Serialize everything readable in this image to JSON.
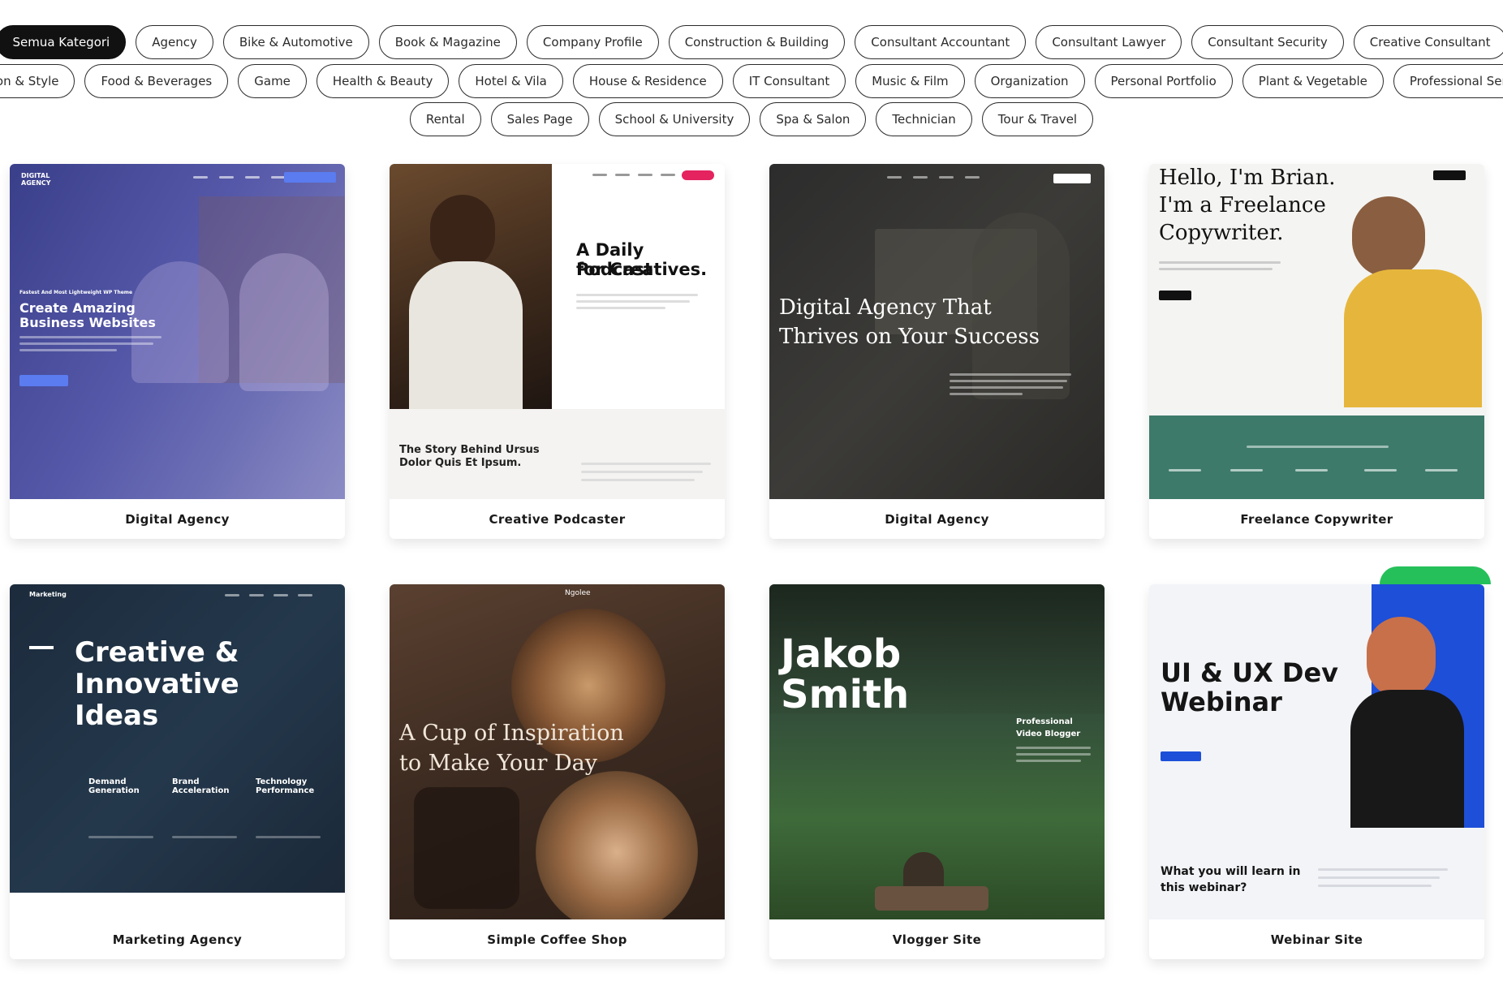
{
  "filters": {
    "row1": [
      "Semua Kategori",
      "Agency",
      "Bike & Automotive",
      "Book & Magazine",
      "Company Profile",
      "Construction & Building",
      "Consultant Accountant",
      "Consultant Lawyer",
      "Consultant Security",
      "Creative Consultant"
    ],
    "row2": [
      "Fashion & Style",
      "Food & Beverages",
      "Game",
      "Health & Beauty",
      "Hotel & Vila",
      "House & Residence",
      "IT Consultant",
      "Music & Film",
      "Organization",
      "Personal Portfolio",
      "Plant & Vegetable",
      "Professional Services"
    ],
    "row3": [
      "Rental",
      "Sales Page",
      "School & University",
      "Spa & Salon",
      "Technician",
      "Tour & Travel"
    ],
    "active": "Semua Kategori"
  },
  "cards": [
    {
      "title": "Digital Agency",
      "preview": {
        "logo": "DIGITAL AGENCY",
        "tagline": "Fastest And Most Lightweight WP Theme",
        "headline_1": "Create Amazing",
        "headline_2": "Business Websites"
      }
    },
    {
      "title": "Creative Podcaster",
      "preview": {
        "headline_1": "A Daily Podcast",
        "headline_2": "for Creatives.",
        "story_1": "The Story Behind Ursus",
        "story_2": "Dolor Quis Et Ipsum."
      }
    },
    {
      "title": "Digital Agency",
      "preview": {
        "headline_1": "Digital Agency That",
        "headline_2": "Thrives on Your Success"
      }
    },
    {
      "title": "Freelance Copywriter",
      "preview": {
        "headline_1": "Hello, I'm Brian.",
        "headline_2": "I'm a Freelance",
        "headline_3": "Copywriter."
      }
    },
    {
      "title": "Marketing Agency",
      "preview": {
        "logo": "Marketing",
        "headline_1": "Creative &",
        "headline_2": "Innovative",
        "headline_3": "Ideas",
        "services": [
          "Demand Generation",
          "Brand Acceleration",
          "Technology Performance"
        ]
      }
    },
    {
      "title": "Simple Coffee Shop",
      "preview": {
        "logo": "Ngolee",
        "headline_1": "A Cup of Inspiration",
        "headline_2": "to Make Your Day"
      }
    },
    {
      "title": "Vlogger Site",
      "preview": {
        "headline_1": "Jakob",
        "headline_2": "Smith",
        "role_1": "Professional",
        "role_2": "Video Blogger"
      }
    },
    {
      "title": "Webinar Site",
      "preview": {
        "headline_1": "UI & UX Dev",
        "headline_2": "Webinar",
        "learn_1": "What you will learn in",
        "learn_2": "this webinar?"
      }
    }
  ],
  "colors": {
    "pill_active_bg": "#111111",
    "pill_border": "#2b2b2b",
    "chat_green": "#25c05a"
  }
}
